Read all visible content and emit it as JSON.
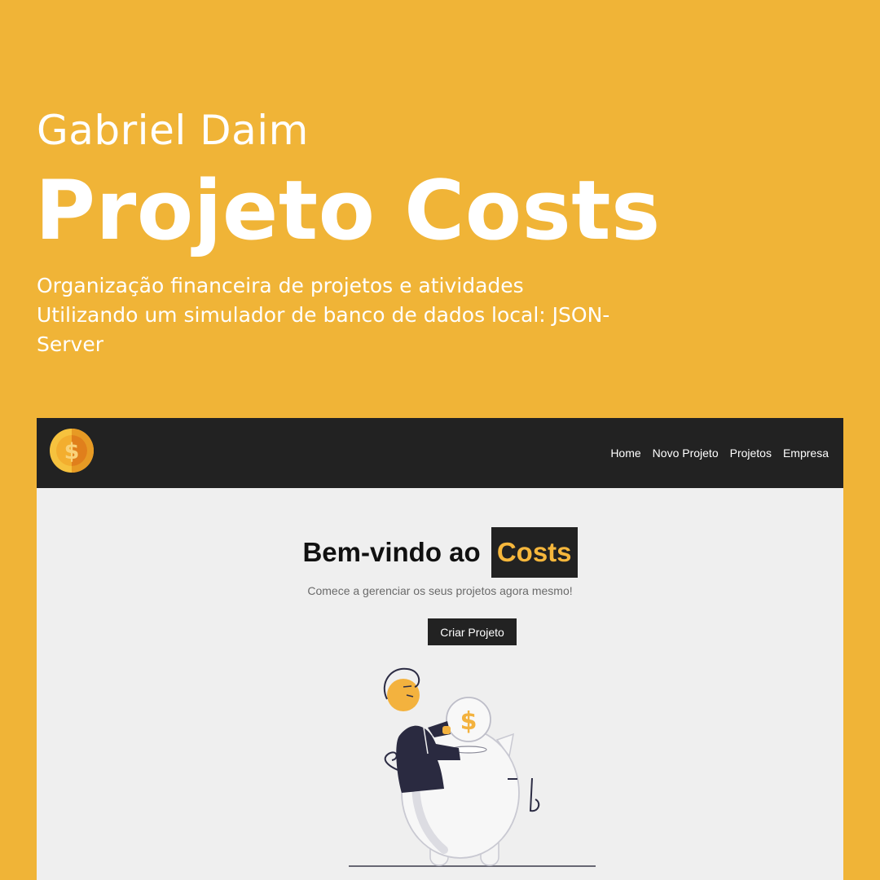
{
  "poster": {
    "author": "Gabriel Daim",
    "title": "Projeto Costs",
    "description_lines": [
      "Organização financeira de projetos e atividades",
      "Utilizando um simulador de banco de dados local: JSON-",
      "Server"
    ]
  },
  "app": {
    "logo_icon": "dollar-coin-icon",
    "nav": {
      "items": [
        "Home",
        "Novo Projeto",
        "Projetos",
        "Empresa"
      ]
    },
    "hero": {
      "title_prefix": "Bem-vindo ao",
      "title_brand": "Costs",
      "subtitle": "Comece a gerenciar os seus projetos agora mesmo!",
      "cta_label": "Criar Projeto"
    },
    "illustration": "piggy-bank-savings-icon"
  },
  "colors": {
    "background": "#f0b437",
    "navbar": "#222222",
    "content_bg": "#efefef",
    "accent": "#f6b73c"
  }
}
